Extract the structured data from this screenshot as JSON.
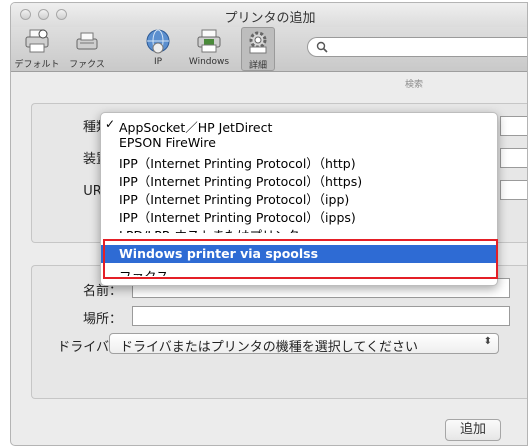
{
  "window": {
    "title": "プリンタの追加"
  },
  "toolbar": {
    "items": [
      {
        "label": "デフォルト",
        "icon": "default-printer-icon"
      },
      {
        "label": "ファクス",
        "icon": "fax-icon"
      },
      {
        "label": "IP",
        "icon": "globe-icon"
      },
      {
        "label": "Windows",
        "icon": "windows-printer-icon"
      },
      {
        "label": "詳細",
        "icon": "gear-icon",
        "selected": true
      }
    ],
    "search_placeholder": "検索"
  },
  "form": {
    "type_label": "種類：",
    "device_label": "装置：",
    "url_label": "URL：",
    "name_label": "名前：",
    "location_label": "場所：",
    "driver_label": "ドライバ：",
    "driver_value": "ドライバまたはプリンタの機種を選択してください"
  },
  "menu": {
    "checked_index": 0,
    "highlighted_index": 7,
    "items": [
      "AppSocket／HP JetDirect",
      "EPSON FireWire",
      "IPP（Internet Printing Protocol）（http)",
      "IPP（Internet Printing Protocol）（https)",
      "IPP（Internet Printing Protocol）（ipp)",
      "IPP（Internet Printing Protocol）（ipps)",
      "LPD/LPR ホストまたはプリンタ",
      "Windows printer via spoolss",
      "ファクス"
    ]
  },
  "buttons": {
    "add": "追加"
  },
  "colors": {
    "highlight": "#2e6bd4",
    "callout": "#e41f26"
  }
}
